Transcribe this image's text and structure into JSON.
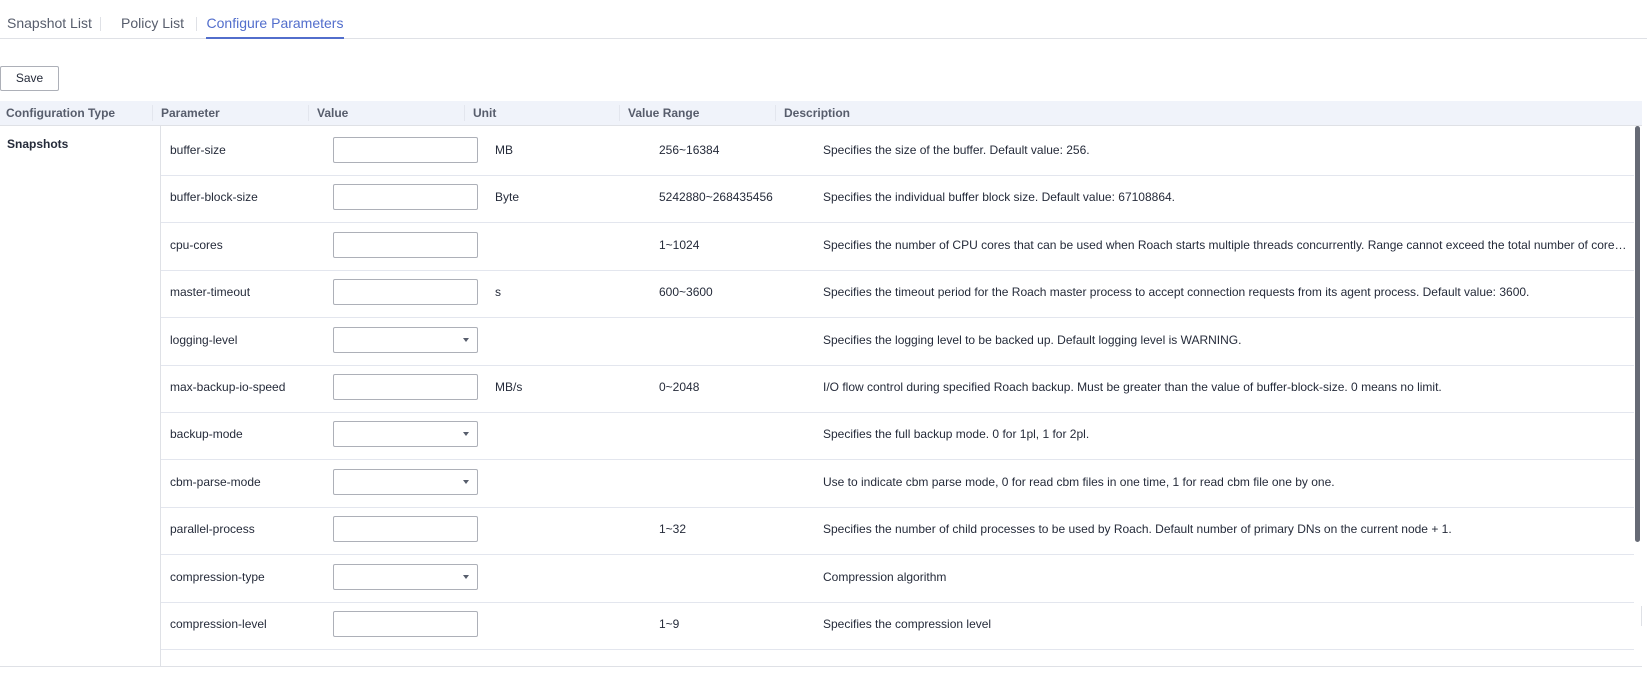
{
  "tabs": [
    {
      "label": "Snapshot List",
      "active": false
    },
    {
      "label": "Policy List",
      "active": false
    },
    {
      "label": "Configure Parameters",
      "active": true
    }
  ],
  "toolbar": {
    "save_label": "Save"
  },
  "table": {
    "headers": {
      "config_type": "Configuration Type",
      "parameter": "Parameter",
      "value": "Value",
      "unit": "Unit",
      "value_range": "Value Range",
      "description": "Description"
    },
    "config_type": "Snapshots",
    "rows": [
      {
        "parameter": "buffer-size",
        "input": "text",
        "value": "",
        "unit": "MB",
        "range": "256~16384",
        "description": "Specifies the size of the buffer. Default value: 256."
      },
      {
        "parameter": "buffer-block-size",
        "input": "text",
        "value": "",
        "unit": "Byte",
        "range": "5242880~268435456",
        "description": "Specifies the individual buffer block size. Default value: 67108864."
      },
      {
        "parameter": "cpu-cores",
        "input": "text",
        "value": "",
        "unit": "",
        "range": "1~1024",
        "description": "Specifies the number of CPU cores that can be used when Roach starts multiple threads concurrently. Range cannot exceed the total number of cores. The default value is the number of CPU cores."
      },
      {
        "parameter": "master-timeout",
        "input": "text",
        "value": "",
        "unit": "s",
        "range": "600~3600",
        "description": "Specifies the timeout period for the Roach master process to accept connection requests from its agent process. Default value: 3600."
      },
      {
        "parameter": "logging-level",
        "input": "select",
        "value": "",
        "unit": "",
        "range": "",
        "description": "Specifies the logging level to be backed up. Default logging level is WARNING."
      },
      {
        "parameter": "max-backup-io-speed",
        "input": "text",
        "value": "",
        "unit": "MB/s",
        "range": "0~2048",
        "description": "I/O flow control during specified Roach backup. Must be greater than the value of buffer-block-size. 0 means no limit."
      },
      {
        "parameter": "backup-mode",
        "input": "select",
        "value": "",
        "unit": "",
        "range": "",
        "description": "Specifies the full backup mode. 0 for 1pl, 1 for 2pl."
      },
      {
        "parameter": "cbm-parse-mode",
        "input": "select",
        "value": "",
        "unit": "",
        "range": "",
        "description": "Use to indicate cbm parse mode, 0 for read cbm files in one time, 1 for read cbm file one by one."
      },
      {
        "parameter": "parallel-process",
        "input": "text",
        "value": "",
        "unit": "",
        "range": "1~32",
        "description": "Specifies the number of child processes to be used by Roach. Default number of primary DNs on the current node + 1."
      },
      {
        "parameter": "compression-type",
        "input": "select",
        "value": "",
        "unit": "",
        "range": "",
        "description": "Compression algorithm"
      },
      {
        "parameter": "compression-level",
        "input": "text",
        "value": "",
        "unit": "",
        "range": "1~9",
        "description": "Specifies the compression level"
      }
    ]
  },
  "colors": {
    "accent": "#526ecc",
    "header_bg": "#f0f3fa",
    "border": "#dfe1e6"
  }
}
